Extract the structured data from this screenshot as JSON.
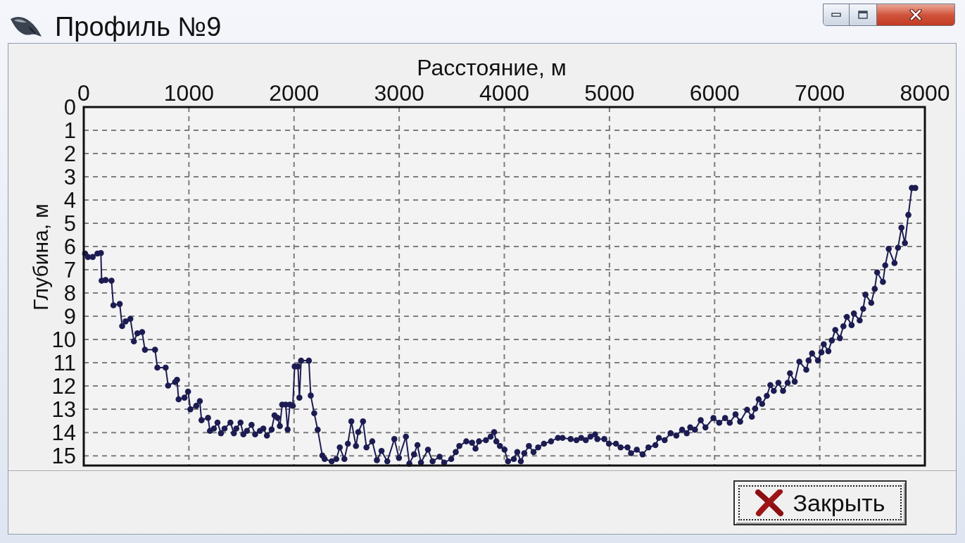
{
  "window": {
    "title": "Профиль №9"
  },
  "chart": {
    "chart_data": {
      "type": "line",
      "xlabel": "Расстояние, м",
      "ylabel": "Глубина, м",
      "xlim": [
        0,
        8000
      ],
      "ylim": [
        15.42,
        0
      ],
      "xticks": [
        0,
        1000,
        2000,
        3000,
        4000,
        5000,
        6000,
        7000,
        8000
      ],
      "yticks": [
        0,
        1,
        2,
        3,
        4,
        5,
        6,
        7,
        8,
        9,
        10,
        11,
        12,
        13,
        14,
        15
      ],
      "grid": true,
      "x": [
        13,
        40,
        85,
        130,
        163,
        170,
        208,
        264,
        282,
        342,
        365,
        398,
        443,
        477,
        510,
        555,
        582,
        678,
        700,
        779,
        802,
        869,
        887,
        902,
        958,
        992,
        1014,
        1070,
        1104,
        1120,
        1182,
        1200,
        1238,
        1272,
        1305,
        1339,
        1395,
        1428,
        1451,
        1491,
        1518,
        1552,
        1596,
        1630,
        1675,
        1708,
        1742,
        1787,
        1814,
        1843,
        1865,
        1887,
        1921,
        1939,
        1961,
        1988,
        2006,
        2037,
        2051,
        2067,
        2141,
        2159,
        2192,
        2225,
        2269,
        2291,
        2358,
        2402,
        2435,
        2479,
        2512,
        2545,
        2589,
        2611,
        2656,
        2689,
        2744,
        2788,
        2832,
        2887,
        2954,
        2998,
        3064,
        3097,
        3141,
        3174,
        3207,
        3274,
        3318,
        3384,
        3428,
        3495,
        3538,
        3572,
        3638,
        3693,
        3726,
        3759,
        3825,
        3870,
        3903,
        3924,
        3958,
        4002,
        4035,
        4090,
        4123,
        4157,
        4190,
        4234,
        4278,
        4322,
        4377,
        4444,
        4510,
        4554,
        4631,
        4686,
        4731,
        4775,
        4819,
        4863,
        4885,
        4951,
        4995,
        5062,
        5106,
        5172,
        5205,
        5260,
        5315,
        5371,
        5437,
        5470,
        5525,
        5581,
        5636,
        5691,
        5735,
        5768,
        5813,
        5868,
        5913,
        5989,
        6044,
        6100,
        6144,
        6199,
        6243,
        6309,
        6354,
        6386,
        6419,
        6452,
        6497,
        6530,
        6563,
        6607,
        6651,
        6695,
        6717,
        6762,
        6806,
        6872,
        6894,
        6927,
        6983,
        7016,
        7038,
        7082,
        7115,
        7148,
        7192,
        7225,
        7258,
        7303,
        7325,
        7380,
        7413,
        7435,
        7490,
        7523,
        7546,
        7601,
        7623,
        7656,
        7711,
        7744,
        7777,
        7810,
        7843,
        7876,
        7909
      ],
      "series": [
        {
          "color": "#1c1c52",
          "marker": "circle",
          "values": [
            6.3,
            6.45,
            6.45,
            6.3,
            6.28,
            7.47,
            7.44,
            7.47,
            8.53,
            8.47,
            9.42,
            9.22,
            9.11,
            10.08,
            9.73,
            9.68,
            10.44,
            10.44,
            11.21,
            11.21,
            11.98,
            11.83,
            11.73,
            12.57,
            12.5,
            12.24,
            13.0,
            12.85,
            12.65,
            13.47,
            13.37,
            13.93,
            13.83,
            13.57,
            14.03,
            13.83,
            13.57,
            14.03,
            13.83,
            13.57,
            14.08,
            13.93,
            13.67,
            14.08,
            13.93,
            13.83,
            14.13,
            13.87,
            13.26,
            13.37,
            13.72,
            12.8,
            12.8,
            13.87,
            12.8,
            12.85,
            11.16,
            11.16,
            12.5,
            10.91,
            10.91,
            12.41,
            13.17,
            13.88,
            14.99,
            15.14,
            15.24,
            15.14,
            14.64,
            15.14,
            14.48,
            13.52,
            14.58,
            13.98,
            13.52,
            14.64,
            14.38,
            15.19,
            14.79,
            15.24,
            14.28,
            15.09,
            14.18,
            15.34,
            14.94,
            14.54,
            15.29,
            14.74,
            15.24,
            15.04,
            15.29,
            15.14,
            14.84,
            14.58,
            14.38,
            14.44,
            14.69,
            14.38,
            14.33,
            14.18,
            13.98,
            14.38,
            14.58,
            14.74,
            15.24,
            15.14,
            14.84,
            15.24,
            14.89,
            14.58,
            14.84,
            14.64,
            14.48,
            14.38,
            14.23,
            14.23,
            14.28,
            14.33,
            14.23,
            14.33,
            14.18,
            14.08,
            14.28,
            14.28,
            14.48,
            14.48,
            14.64,
            14.64,
            14.89,
            14.74,
            14.94,
            14.64,
            14.54,
            14.23,
            14.33,
            14.03,
            14.13,
            13.88,
            14.03,
            13.78,
            13.88,
            13.47,
            13.78,
            13.38,
            13.58,
            13.38,
            13.58,
            13.22,
            13.53,
            13.02,
            13.32,
            12.97,
            12.57,
            12.77,
            12.42,
            11.96,
            12.21,
            11.86,
            12.21,
            11.86,
            11.45,
            11.81,
            10.95,
            11.3,
            10.9,
            10.6,
            10.9,
            10.55,
            10.2,
            10.5,
            10.04,
            9.59,
            9.94,
            9.43,
            9.03,
            9.38,
            8.88,
            9.18,
            8.68,
            8.07,
            8.42,
            7.82,
            7.11,
            7.52,
            6.81,
            6.1,
            6.71,
            6.05,
            5.19,
            5.85,
            4.64,
            3.48,
            3.48
          ]
        }
      ]
    }
  },
  "buttons": [
    {
      "label": "Закрыть",
      "focused": true
    }
  ]
}
